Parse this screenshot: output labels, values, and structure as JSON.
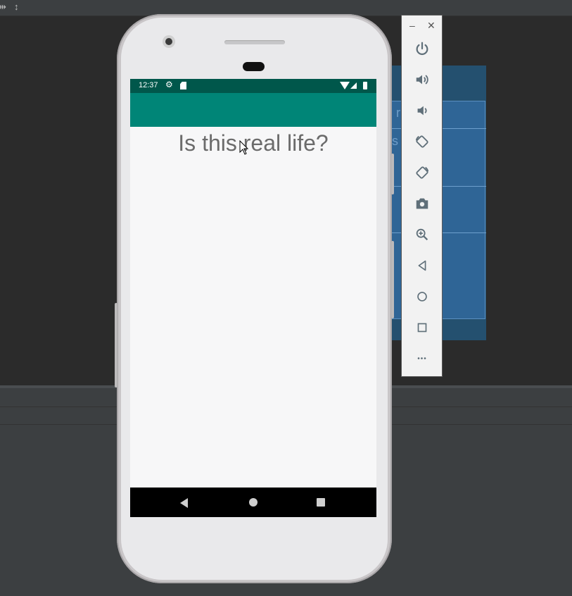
{
  "ide": {
    "toolbar_icons": [
      "resize-horizontal-icon",
      "resize-vertical-icon"
    ]
  },
  "blueprint": {
    "text_1": "r   ?",
    "text_2": "s      life."
  },
  "status_bar": {
    "time": "12:37"
  },
  "app": {
    "main_text": "Is this real life?",
    "colors": {
      "status_bar": "#00574b",
      "app_bar": "#008577",
      "background": "#f7f7f8",
      "text": "#6b6b6b"
    }
  },
  "emulator_toolbar": {
    "window_controls": [
      "minimize-icon",
      "close-icon"
    ],
    "minimize_label": "–",
    "close_label": "✕",
    "buttons": [
      "power-icon",
      "volume-up-icon",
      "volume-down-icon",
      "rotate-left-icon",
      "rotate-right-icon",
      "screenshot-icon",
      "zoom-icon",
      "back-icon",
      "home-icon",
      "overview-icon",
      "more-icon"
    ],
    "more_label": "•••"
  }
}
